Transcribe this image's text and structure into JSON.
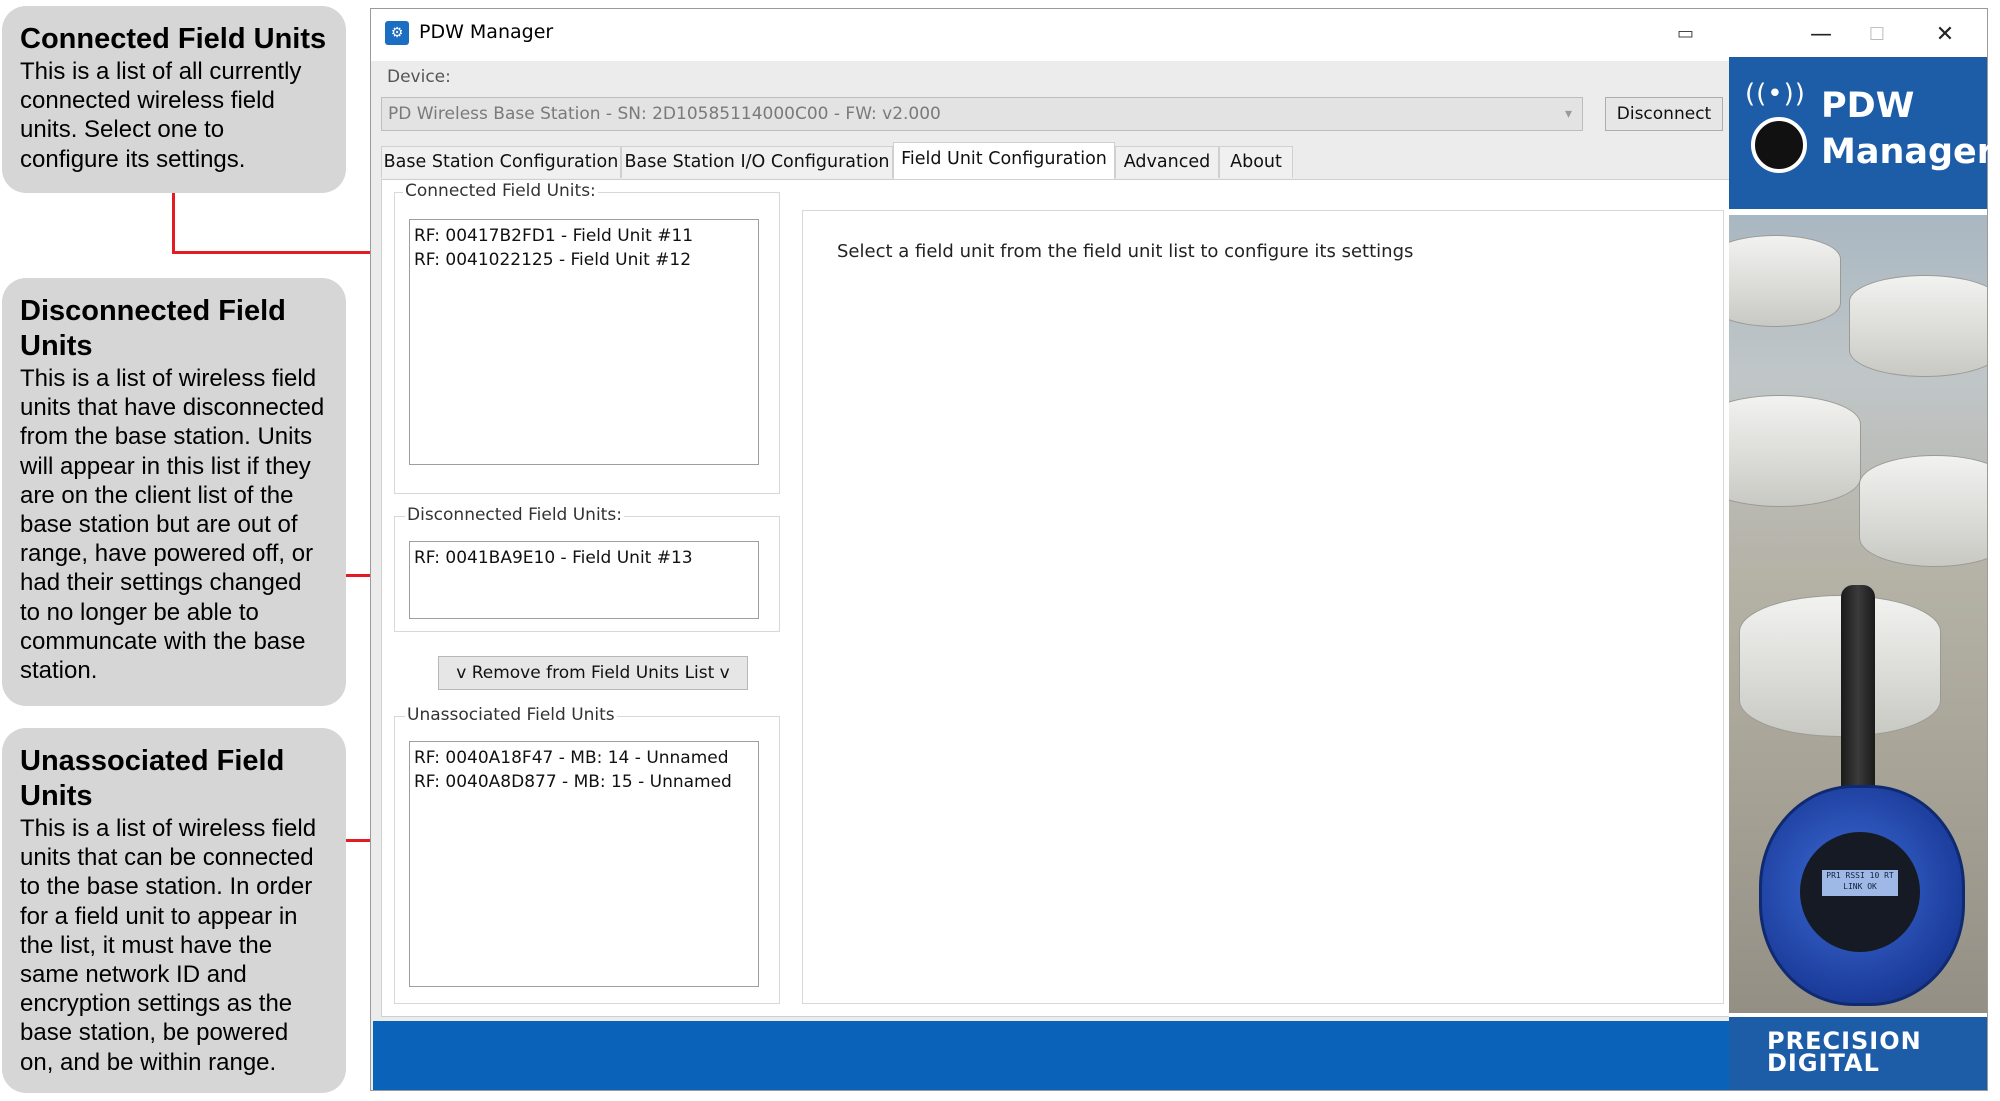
{
  "callouts": {
    "connected": {
      "title": "Connected Field Units",
      "body": "This is a list of all currently connected wireless field units. Select one to configure its settings."
    },
    "disconnected": {
      "title": "Disconnected Field Units",
      "body": "This is a list of wireless field units that have disconnected from the base station. Units will appear in this list if they are on the client list of the base station but are out of range, have powered off, or had their settings changed to no longer be able to communcate with the base station."
    },
    "unassociated": {
      "title": "Unassociated Field Units",
      "body": "This is a list of wireless field units that can be connected to the base station. In order for a field unit to appear in the list, it must have the same network ID and encryption settings as the base station, be powered on, and be within range."
    }
  },
  "window": {
    "title": "PDW Manager",
    "controls": {
      "minimize": "—",
      "maximize": "☐",
      "close": "✕"
    }
  },
  "device": {
    "label": "Device:",
    "selected": "PD Wireless Base Station - SN: 2D10585114000C00 - FW: v2.000",
    "disconnect_label": "Disconnect"
  },
  "tabs": [
    {
      "label": "Base Station Configuration"
    },
    {
      "label": "Base Station I/O Configuration"
    },
    {
      "label": "Field Unit Configuration",
      "active": true
    },
    {
      "label": "Advanced"
    },
    {
      "label": "About"
    }
  ],
  "field_units": {
    "connected": {
      "label": "Connected Field Units:",
      "items": [
        "RF: 00417B2FD1 - Field Unit #11",
        "RF: 0041022125 - Field Unit #12"
      ]
    },
    "disconnected": {
      "label": "Disconnected Field Units:",
      "items": [
        "RF: 0041BA9E10 - Field Unit #13"
      ]
    },
    "remove_button": "v Remove from Field Units List v",
    "unassociated": {
      "label": "Unassociated Field Units",
      "items": [
        "RF: 0040A18F47 - MB: 14 - Unnamed",
        "RF: 0040A8D877 - MB: 15 - Unnamed"
      ]
    }
  },
  "config": {
    "prompt": "Select a field unit from the field unit list to configure its settings"
  },
  "brand": {
    "name_line1": "PDW",
    "name_line2": "Manager",
    "device_lcd_line1": "PR1 RSSI 10 RT",
    "device_lcd_line2": "LINK OK",
    "footer_line1": "PRECISION",
    "footer_line2": "DIGITAL"
  },
  "colors": {
    "callout_bg": "#d6d6d6",
    "arrow": "#e31b23",
    "status_bar": "#0a63b8",
    "brand_blue": "#1d5da8"
  }
}
